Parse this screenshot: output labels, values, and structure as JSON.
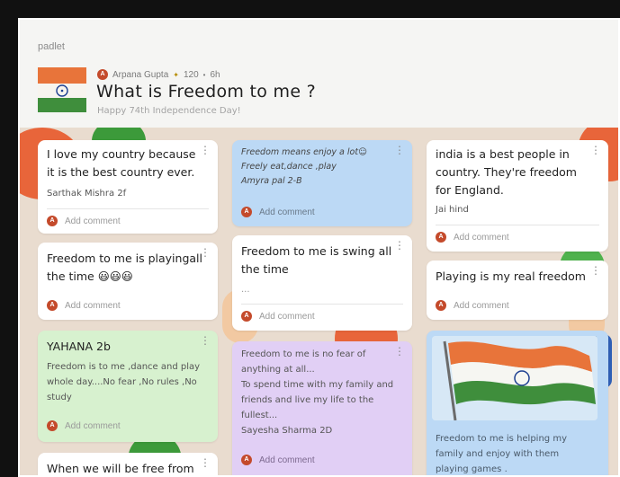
{
  "header": {
    "brand": "padlet",
    "author_initial": "A",
    "author": "Arpana Gupta",
    "karma": "120",
    "age": "6h",
    "title": "What is Freedom to me ?",
    "subtitle": "Happy 74th Independence Day!",
    "dot": "•",
    "star": "✦"
  },
  "comment_label": "Add comment",
  "menu_glyph": "⋮",
  "cards": {
    "c1": {
      "text": "I love my country because it is the best country ever.",
      "sig": "Sarthak Mishra 2f"
    },
    "c2": {
      "text": "Freedom to me is playingall the time 😃😃😃"
    },
    "c3": {
      "title": "YAHANA 2b",
      "text": "Freedom is to me ,dance and play whole day....No fear ,No rules ,No study"
    },
    "c4": {
      "text": "When we will be free from"
    },
    "c5": {
      "line1": "Freedom means enjoy a lot☺",
      "line2": "Freely eat,dance ,play",
      "line3": "Amyra pal 2-B"
    },
    "c6": {
      "text": "Freedom to me is swing all the time",
      "extra": "..."
    },
    "c7": {
      "line1": "Freedom to me is no fear of anything at all...",
      "line2": "To spend time with my family and friends and live my life to the fullest...",
      "line3": "Sayesha Sharma 2D"
    },
    "c8": {
      "text": "india is a best people in country. They're freedom for England.",
      "sig": "Jai hind"
    },
    "c9": {
      "text": "Playing is my real freedom"
    },
    "c10": {
      "text": "Freedom to me is helping my family and enjoy with them playing games ."
    }
  }
}
